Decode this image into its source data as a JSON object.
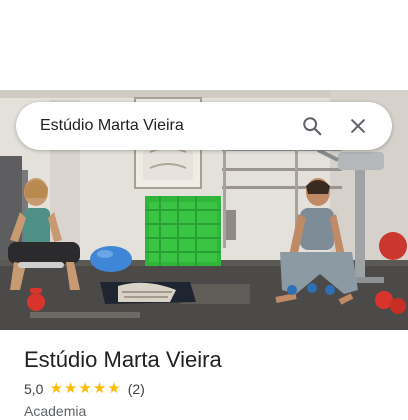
{
  "search": {
    "query": "Estúdio Marta Vieira"
  },
  "place": {
    "name": "Estúdio Marta Vieira",
    "rating": "5,0",
    "review_count": "(2)",
    "category": "Academia",
    "stars": 5
  },
  "icons": {
    "search": "search-icon",
    "close": "close-icon",
    "star": "star-icon"
  },
  "colors": {
    "star": "#fbbc04",
    "mat_green": "#2fb53a",
    "ball_blue": "#3f87d6",
    "kettlebell_red": "#d8342b"
  }
}
